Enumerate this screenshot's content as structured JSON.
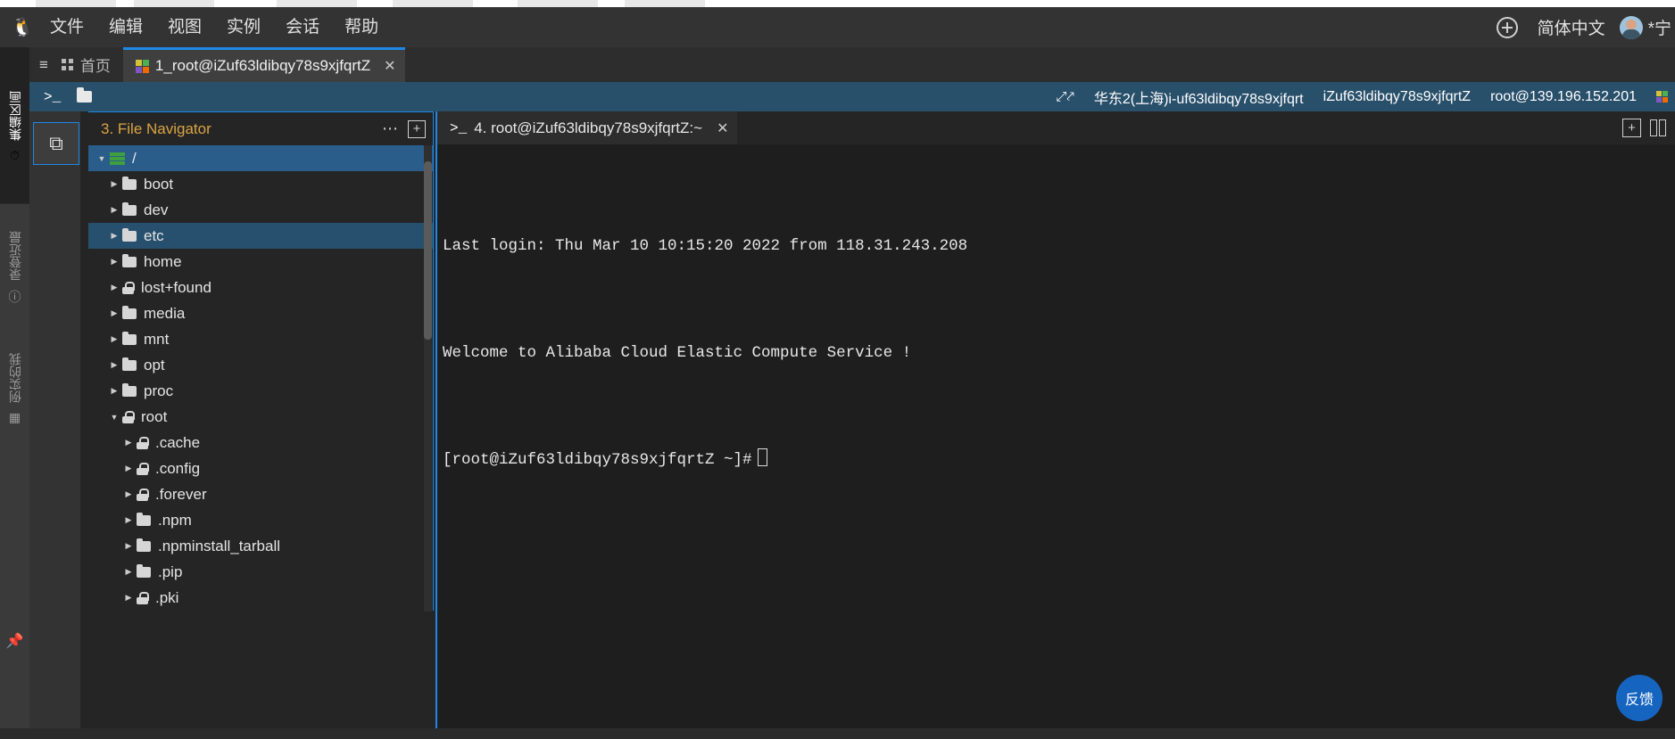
{
  "browser": {
    "tabs": [
      "",
      "",
      "",
      "",
      "",
      "",
      ""
    ]
  },
  "menubar": {
    "logo_icon": "penguin-icon",
    "items": [
      "文件",
      "编辑",
      "视图",
      "实例",
      "会话",
      "帮助"
    ],
    "add_icon": "plus-circle-icon",
    "language": "简体中文",
    "user": "*宁",
    "avatar_icon": "avatar-icon"
  },
  "rail": {
    "groups": [
      {
        "label": "集编区画",
        "icon": "history-add-icon"
      },
      {
        "label": "录登近最",
        "icon": "clock-icon"
      },
      {
        "label": "例实的我",
        "icon": "grid-icon"
      }
    ],
    "pin_icon": "pin-icon"
  },
  "tabbar": {
    "collapse_icon": "collapse-panel-icon",
    "home_icon": "grid-icon",
    "home_label": "首页",
    "terminal_tab": {
      "icon": "puzzle-icon",
      "label": "1_root@iZuf63ldibqy78s9xjfqrtZ",
      "close_icon": "close-icon"
    }
  },
  "infobar": {
    "prompt_icon": "terminal-prompt-icon",
    "folder_icon": "folder-icon",
    "expand_icon": "expand-icon",
    "region": "华东2(上海)i-uf63ldibqy78s9xjfqrt",
    "instance": "iZuf63ldibqy78s9xjfqrtZ",
    "connection": "root@139.196.152.201",
    "puzzle_icon": "puzzle-icon"
  },
  "workspace": {
    "side_button_icon": "copy-panes-icon"
  },
  "filenav": {
    "title": "3. File Navigator",
    "title_color": "#d9a443",
    "more_icon": "more-options-icon",
    "add_icon": "add-icon",
    "tree": [
      {
        "label": "/",
        "icon": "server-icon",
        "indent": 0,
        "twisty": "down",
        "state": "selected"
      },
      {
        "label": "boot",
        "icon": "folder-icon",
        "indent": 1,
        "twisty": "right",
        "state": "normal"
      },
      {
        "label": "dev",
        "icon": "folder-icon",
        "indent": 1,
        "twisty": "right",
        "state": "normal"
      },
      {
        "label": "etc",
        "icon": "folder-icon",
        "indent": 1,
        "twisty": "right",
        "state": "highlight"
      },
      {
        "label": "home",
        "icon": "folder-icon",
        "indent": 1,
        "twisty": "right",
        "state": "normal"
      },
      {
        "label": "lost+found",
        "icon": "lock-icon",
        "indent": 1,
        "twisty": "right",
        "state": "normal"
      },
      {
        "label": "media",
        "icon": "folder-icon",
        "indent": 1,
        "twisty": "right",
        "state": "normal"
      },
      {
        "label": "mnt",
        "icon": "folder-icon",
        "indent": 1,
        "twisty": "right",
        "state": "normal"
      },
      {
        "label": "opt",
        "icon": "folder-icon",
        "indent": 1,
        "twisty": "right",
        "state": "normal"
      },
      {
        "label": "proc",
        "icon": "folder-icon",
        "indent": 1,
        "twisty": "right",
        "state": "normal"
      },
      {
        "label": "root",
        "icon": "lock-icon",
        "indent": 1,
        "twisty": "down",
        "state": "normal"
      },
      {
        "label": ".cache",
        "icon": "lock-icon",
        "indent": 2,
        "twisty": "right",
        "state": "normal"
      },
      {
        "label": ".config",
        "icon": "lock-icon",
        "indent": 2,
        "twisty": "right",
        "state": "normal"
      },
      {
        "label": ".forever",
        "icon": "lock-icon",
        "indent": 2,
        "twisty": "right",
        "state": "normal"
      },
      {
        "label": ".npm",
        "icon": "folder-icon",
        "indent": 2,
        "twisty": "right",
        "state": "normal"
      },
      {
        "label": ".npminstall_tarball",
        "icon": "folder-icon",
        "indent": 2,
        "twisty": "right",
        "state": "normal"
      },
      {
        "label": ".pip",
        "icon": "folder-icon",
        "indent": 2,
        "twisty": "right",
        "state": "normal"
      },
      {
        "label": ".pki",
        "icon": "lock-icon",
        "indent": 2,
        "twisty": "right",
        "state": "normal"
      }
    ]
  },
  "terminal": {
    "tab": {
      "prompt_icon": "terminal-prompt-icon",
      "label": "4. root@iZuf63ldibqy78s9xjfqrtZ:~",
      "close_icon": "close-icon"
    },
    "add_icon": "add-tab-icon",
    "split_icon": "split-pane-icon",
    "lines": [
      "Last login: Thu Mar 10 10:15:20 2022 from 118.31.243.208",
      "",
      "Welcome to Alibaba Cloud Elastic Compute Service !",
      ""
    ],
    "prompt": "[root@iZuf63ldibqy78s9xjfqrtZ ~]#"
  },
  "feedback": {
    "label": "反馈"
  },
  "colors": {
    "accent_blue": "#1e88e5",
    "infobar_blue": "#29506b",
    "selection_blue": "#2a5d8a",
    "panel_dark": "#252526",
    "terminal_bg": "#1e1e1e"
  }
}
